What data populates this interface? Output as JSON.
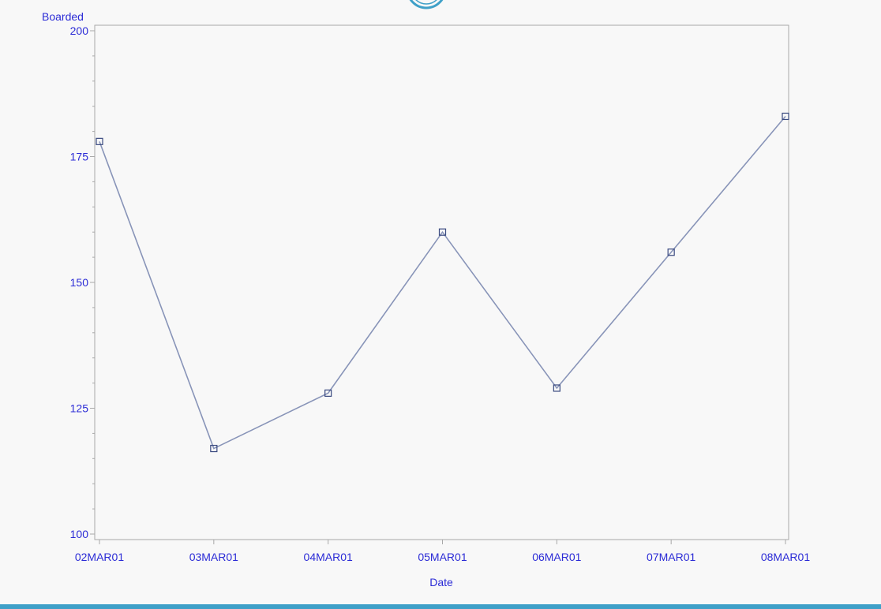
{
  "colors": {
    "axis_text": "#2b2bd6",
    "line": "#8894b8",
    "marker": "#3a4a80",
    "frame": "#a8a8a8",
    "accent_bar": "#3fa0c8",
    "logo": "#3fa0c8"
  },
  "icons": {
    "top_logo": "circle-logo-icon",
    "marker": "square-marker-icon"
  },
  "chart_data": {
    "type": "line",
    "title": "",
    "xlabel": "Date",
    "ylabel": "Boarded",
    "categories": [
      "02MAR01",
      "03MAR01",
      "04MAR01",
      "05MAR01",
      "06MAR01",
      "07MAR01",
      "08MAR01"
    ],
    "series": [
      {
        "values": [
          178,
          117,
          128,
          160,
          129,
          156,
          183
        ]
      }
    ],
    "ylim": [
      100,
      200
    ],
    "yticks": [
      100,
      125,
      150,
      175,
      200
    ],
    "y_minor_step": 5,
    "grid": false,
    "marker": "square"
  }
}
